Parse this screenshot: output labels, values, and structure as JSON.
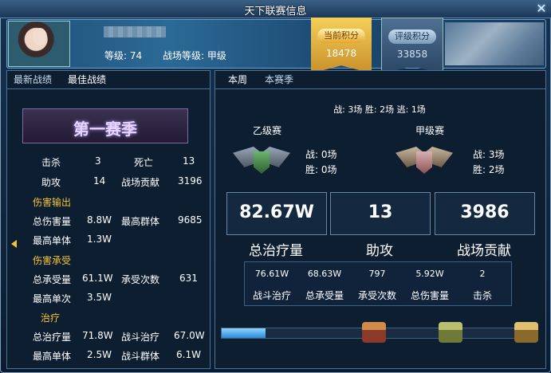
{
  "window": {
    "title": "天下联赛信息"
  },
  "player": {
    "level_label": "等级: 74",
    "field_level_label": "战场等级: 甲级"
  },
  "badges": {
    "current_score_label": "当前积分",
    "current_score_value": "18478",
    "rating_score_label": "评级积分",
    "rating_score_value": "33858"
  },
  "left": {
    "tabs": [
      "最新战绩",
      "最佳战绩"
    ],
    "season_title": "第一赛季",
    "rows": {
      "kill_label": "击杀",
      "kill_value": "3",
      "death_label": "死亡",
      "death_value": "13",
      "assist_label": "助攻",
      "assist_value": "14",
      "contrib_label": "战场贡献",
      "contrib_value": "3196",
      "dmg_out_section": "伤害输出",
      "total_dmg_label": "总伤害量",
      "total_dmg_value": "8.8W",
      "max_group_label": "最高群体",
      "max_group_value": "9685",
      "max_single_label": "最高单体",
      "max_single_value": "1.3W",
      "dmg_in_section": "伤害承受",
      "total_taken_label": "总承受量",
      "total_taken_value": "61.1W",
      "taken_count_label": "承受次数",
      "taken_count_value": "631",
      "max_taken_label": "最高单次",
      "max_taken_value": "3.5W",
      "heal_section": "治疗",
      "total_heal_label": "总治疗量",
      "total_heal_value": "71.8W",
      "battle_heal_label": "战斗治疗",
      "battle_heal_value": "67.0W",
      "heal_single_label": "最高单体",
      "heal_single_value": "2.5W",
      "heal_group_label": "战斗群体",
      "heal_group_value": "6.1W"
    }
  },
  "right": {
    "tabs": [
      "本周",
      "本赛季"
    ],
    "summary": "战: 3场    胜: 2场    逃: 1场",
    "league_b": {
      "name": "乙级赛",
      "battles": "战: 0场",
      "wins": "胜: 0场"
    },
    "league_a": {
      "name": "甲级赛",
      "battles": "战: 3场",
      "wins": "胜: 2场"
    },
    "big": [
      {
        "value": "82.67W",
        "label": "总治疗量"
      },
      {
        "value": "13",
        "label": "助攻"
      },
      {
        "value": "3986",
        "label": "战场贡献"
      }
    ],
    "sub": [
      {
        "value": "76.61W",
        "label": "战斗治疗"
      },
      {
        "value": "68.63W",
        "label": "总承受量"
      },
      {
        "value": "797",
        "label": "承受次数"
      },
      {
        "value": "5.92W",
        "label": "总伤害量"
      },
      {
        "value": "2",
        "label": "击杀"
      }
    ],
    "progress_fraction": 0.14
  },
  "colors": {
    "gold": "#f4c43a",
    "accent_blue": "#2b8ad6"
  }
}
